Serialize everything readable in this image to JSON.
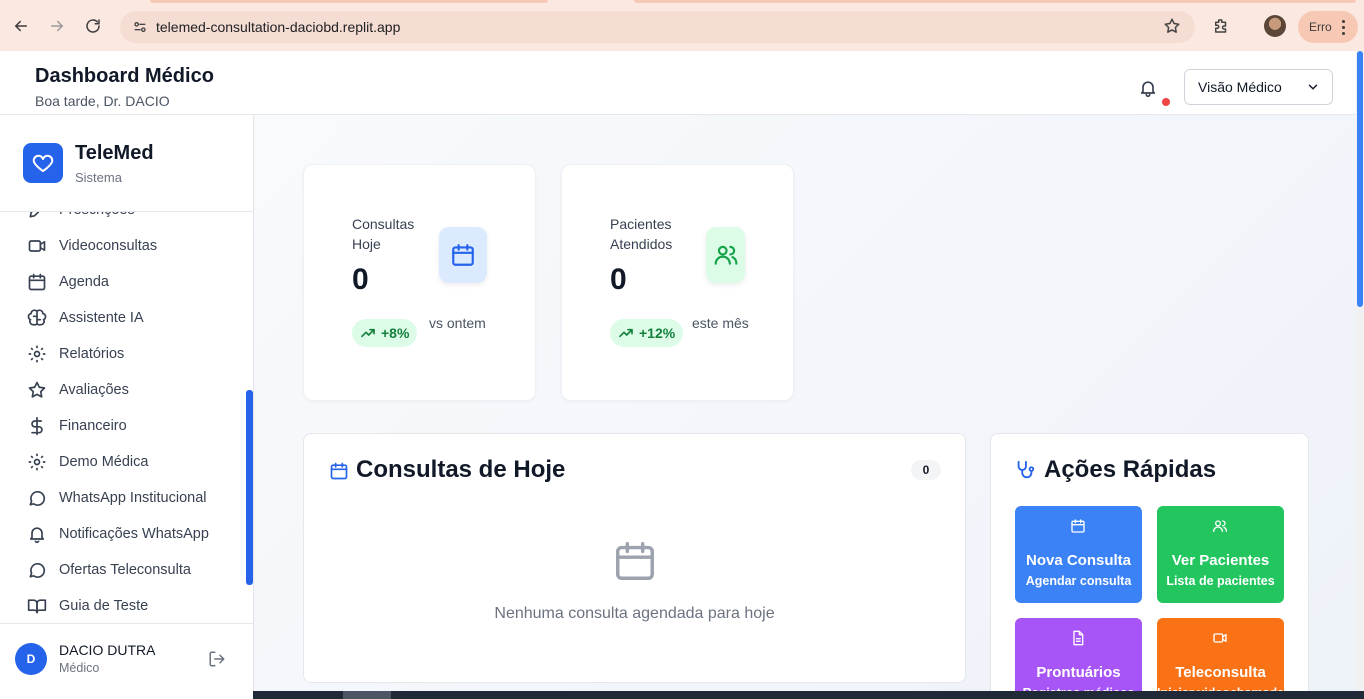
{
  "browser": {
    "url": "telemed-consultation-daciobd.replit.app",
    "profile_button_label": "Erro"
  },
  "header": {
    "title": "Dashboard Médico",
    "subtitle": "Boa tarde, Dr. DACIO",
    "view_select_value": "Visão Médico"
  },
  "sidebar": {
    "brand_name": "TeleMed",
    "brand_sub": "Sistema",
    "items": [
      {
        "label": "Prescrições",
        "icon": "pen-icon"
      },
      {
        "label": "Videoconsultas",
        "icon": "video-icon"
      },
      {
        "label": "Agenda",
        "icon": "calendar-icon"
      },
      {
        "label": "Assistente IA",
        "icon": "brain-icon"
      },
      {
        "label": "Relatórios",
        "icon": "gear-icon"
      },
      {
        "label": "Avaliações",
        "icon": "star-icon"
      },
      {
        "label": "Financeiro",
        "icon": "dollar-icon"
      },
      {
        "label": "Demo Médica",
        "icon": "gear-icon"
      },
      {
        "label": "WhatsApp Institucional",
        "icon": "chat-icon"
      },
      {
        "label": "Notificações WhatsApp",
        "icon": "bell-icon"
      },
      {
        "label": "Ofertas Teleconsulta",
        "icon": "chat-icon"
      },
      {
        "label": "Guia de Teste",
        "icon": "book-icon"
      }
    ],
    "user": {
      "initial": "D",
      "name": "DACIO DUTRA",
      "role": "Médico"
    }
  },
  "stats": [
    {
      "label": "Consultas Hoje",
      "value": "0",
      "trend": "+8%",
      "trend_text": "vs ontem",
      "icon": "calendar-icon",
      "icon_bg": "#dbeafe",
      "icon_color": "#2563eb"
    },
    {
      "label": "Pacientes Atendidos",
      "value": "0",
      "trend": "+12%",
      "trend_text": "este mês",
      "icon": "users-icon",
      "icon_bg": "#dcfce7",
      "icon_color": "#16a34a"
    }
  ],
  "consultas": {
    "title": "Consultas de Hoje",
    "count": "0",
    "empty_text": "Nenhuma consulta agendada para hoje"
  },
  "acoes": {
    "title": "Ações Rápidas",
    "items": [
      {
        "title": "Nova Consulta",
        "subtitle": "Agendar consulta",
        "color": "#3b82f6",
        "icon": "calendar-icon"
      },
      {
        "title": "Ver Pacientes",
        "subtitle": "Lista de pacientes",
        "color": "#22c55e",
        "icon": "users-icon"
      },
      {
        "title": "Prontuários",
        "subtitle": "Registros médicos",
        "color": "#a855f7",
        "icon": "file-icon"
      },
      {
        "title": "Teleconsulta",
        "subtitle": "Iniciar videochamada",
        "color": "#f97316",
        "icon": "video-icon"
      }
    ]
  }
}
